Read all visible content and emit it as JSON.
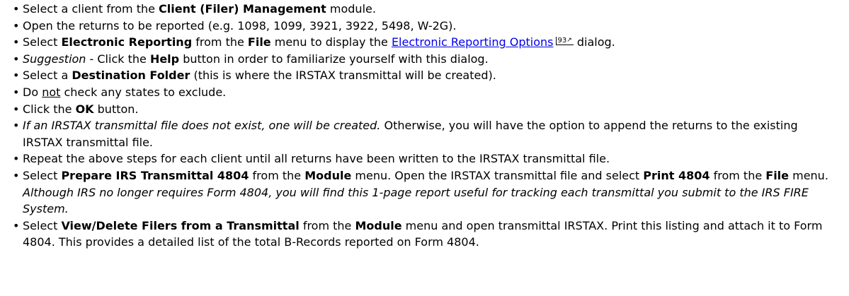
{
  "steps": [
    {
      "segments": [
        {
          "t": "Select a client from the "
        },
        {
          "t": "Client (Filer) Management",
          "b": true,
          "name": "client-filer-management-text"
        },
        {
          "t": " module."
        }
      ]
    },
    {
      "segments": [
        {
          "t": "Open the returns to be reported (e.g. 1098, 1099, 3921, 3922, 5498, W-2G)."
        }
      ]
    },
    {
      "segments": [
        {
          "t": "Select "
        },
        {
          "t": "Electronic Reporting",
          "b": true,
          "name": "electronic-reporting-text"
        },
        {
          "t": " from the "
        },
        {
          "t": "File",
          "b": true,
          "name": "file-menu-text"
        },
        {
          "t": " menu to display the "
        },
        {
          "t": "Electronic Reporting Options",
          "link": true,
          "name": "electronic-reporting-options-link"
        },
        {
          "t": "93",
          "pageref": true,
          "name": "page-reference-93"
        },
        {
          "t": " dialog."
        }
      ]
    },
    {
      "segments": [
        {
          "t": "Suggestion",
          "i": true
        },
        {
          "t": " - Click the "
        },
        {
          "t": "Help",
          "b": true,
          "name": "help-button-text"
        },
        {
          "t": " button in order to familiarize yourself with this dialog."
        }
      ]
    },
    {
      "segments": [
        {
          "t": "Select a "
        },
        {
          "t": "Destination Folder",
          "b": true,
          "name": "destination-folder-text"
        },
        {
          "t": " (this is where the IRSTAX transmittal will be created)."
        }
      ]
    },
    {
      "segments": [
        {
          "t": "Do "
        },
        {
          "t": "not",
          "u": true
        },
        {
          "t": " check any states to exclude."
        }
      ]
    },
    {
      "segments": [
        {
          "t": "Click the "
        },
        {
          "t": "OK",
          "b": true,
          "name": "ok-button-text"
        },
        {
          "t": " button."
        }
      ]
    },
    {
      "segments": [
        {
          "t": "If an IRSTAX transmittal file does not exist, one will be created.",
          "i": true
        },
        {
          "t": " Otherwise, you will have the option to append the returns to the existing IRSTAX transmittal file."
        }
      ]
    },
    {
      "segments": [
        {
          "t": "Repeat the above steps for each client until all returns have been written to the IRSTAX transmittal file."
        }
      ]
    },
    {
      "segments": [
        {
          "t": "Select "
        },
        {
          "t": "Prepare IRS Transmittal 4804",
          "b": true,
          "name": "prepare-irs-transmittal-text"
        },
        {
          "t": " from the "
        },
        {
          "t": "Module",
          "b": true,
          "name": "module-menu-text"
        },
        {
          "t": " menu. Open the IRSTAX transmittal file and select "
        },
        {
          "t": "Print 4804",
          "b": true,
          "name": "print-4804-text"
        },
        {
          "t": " from the "
        },
        {
          "t": "File",
          "b": true,
          "name": "file-menu-text"
        },
        {
          "t": " menu. "
        },
        {
          "t": "Although IRS no longer requires Form 4804, you will find this 1-page report useful for tracking each transmittal you submit to the IRS FIRE System.",
          "i": true
        }
      ]
    },
    {
      "segments": [
        {
          "t": "Select "
        },
        {
          "t": "View/Delete Filers from a Transmittal",
          "b": true,
          "name": "view-delete-filers-text"
        },
        {
          "t": " from the "
        },
        {
          "t": "Module",
          "b": true,
          "name": "module-menu-text"
        },
        {
          "t": " menu and open transmittal IRSTAX. Print this listing and attach it to Form 4804. This provides a detailed list of the total B-Records reported on Form 4804."
        }
      ]
    }
  ]
}
